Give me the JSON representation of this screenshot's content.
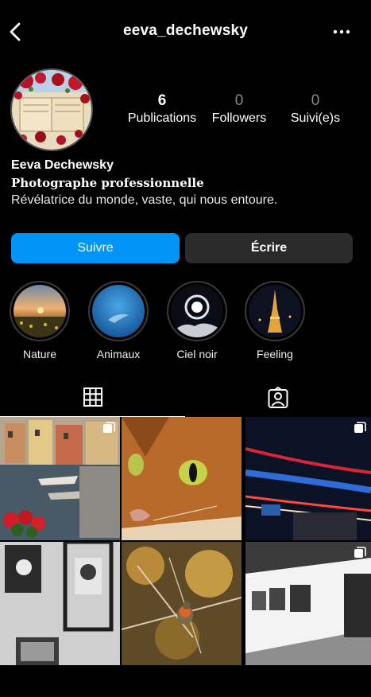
{
  "header": {
    "username": "eeva_dechewsky",
    "back_icon": "chevron-left-icon",
    "more_icon": "more-horizontal-icon"
  },
  "profile": {
    "stats": [
      {
        "value": "6",
        "label": "Publications"
      },
      {
        "value": "0",
        "label": "Followers"
      },
      {
        "value": "0",
        "label": "Suivi(e)s"
      }
    ],
    "name": "Eeva Dechewsky",
    "category": "Photographe professionnelle",
    "bio": "Révélatrice du monde, vaste, qui nous entoure."
  },
  "actions": {
    "follow_label": "Suivre",
    "message_label": "Écrire",
    "follow_color": "#0095f6"
  },
  "highlights": [
    {
      "label": "Nature"
    },
    {
      "label": "Animaux"
    },
    {
      "label": "Ciel noir"
    },
    {
      "label": "Feeling"
    }
  ],
  "tabs": [
    {
      "icon": "grid-icon",
      "active": true
    },
    {
      "icon": "tagged-person-icon",
      "active": false
    }
  ],
  "posts": [
    {
      "subject": "canal harbor with boats and red flowers",
      "multiple": true
    },
    {
      "subject": "close-up of an orange cat",
      "multiple": false
    },
    {
      "subject": "city light trails at night",
      "multiple": true
    },
    {
      "subject": "black-and-white photo frames on a wall",
      "multiple": false
    },
    {
      "subject": "robin on branches in autumn",
      "multiple": false
    },
    {
      "subject": "gallery wall with framed photos",
      "multiple": true
    }
  ]
}
